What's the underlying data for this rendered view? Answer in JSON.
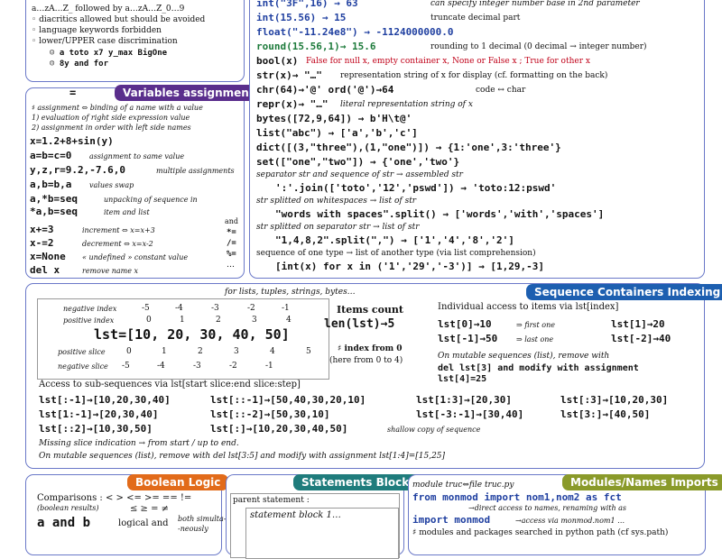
{
  "identifiers": {
    "rule1": "a…zA…Z_ followed by a…zA…Z_0…9",
    "rule2": "◦ diacritics allowed but should be avoided",
    "rule3": "◦ language keywords forbidden",
    "rule4": "◦ lower/UPPER case discrimination",
    "ex_ok": "☺ a toto x7 y_max BigOne",
    "ex_bad": "☹ 8y and for"
  },
  "conversions": {
    "lines": [
      {
        "code": "int(\"3F\",16) → 63",
        "note": "can specify integer number base in 2nd parameter"
      },
      {
        "code": "int(15.56) → 15",
        "note": "truncate decimal part"
      },
      {
        "code": "float(\"-11.24e8\") → -1124000000.0",
        "note": ""
      },
      {
        "code": "round(15.56,1)→ 15.6",
        "note": "rounding to 1 decimal (0 decimal → integer number)"
      },
      {
        "code": "bool(x)",
        "note": "False for null x, empty container x, None or False x ; True for other x"
      },
      {
        "code": "str(x)→ \"…\"",
        "note": "representation string of x for display (cf. formatting on the back)"
      },
      {
        "code": "chr(64)→'@'  ord('@')→64",
        "note": "code ↔ char"
      },
      {
        "code": "repr(x)→ \"…\"",
        "note": "literal representation string of x"
      },
      {
        "code": "bytes([72,9,64]) → b'H\\t@'",
        "note": ""
      },
      {
        "code": "list(\"abc\") → ['a','b','c']",
        "note": ""
      },
      {
        "code": "dict([(3,\"three\"),(1,\"one\")]) → {1:'one',3:'three'}",
        "note": ""
      },
      {
        "code": "set([\"one\",\"two\"]) → {'one','two'}",
        "note": ""
      }
    ],
    "sep_text": "separator str and sequence of str → assembled str",
    "join_code": "':'.join(['toto','12','pswd']) → 'toto:12:pswd'",
    "split_ws_text": "str splitted on whitespaces → list of str",
    "split_ws_code": "\"words with  spaces\".split() → ['words','with','spaces']",
    "split_sep_text": "str splitted on separator str → list of str",
    "split_sep_code": "\"1,4,8,2\".split(\",\") → ['1','4','8','2']",
    "seq_text": "sequence of one type → list of another type (via list comprehension)",
    "seq_code": "[int(x) for x in ('1','29','-3')] → [1,29,-3]"
  },
  "variables": {
    "title": "Variables assignment",
    "eq": "=",
    "intro1": "♯ assignment ⇔ binding of a name with a value",
    "intro2": "1) evaluation of right side expression value",
    "intro3": "2) assignment in order with left side names",
    "rows": [
      {
        "code": "x=1.2+8+sin(y)",
        "note": ""
      },
      {
        "code": "a=b=c=0",
        "note": "assignment to same value"
      },
      {
        "code": "y,z,r=9.2,-7.6,0",
        "note": "multiple assignments"
      },
      {
        "code": "a,b=b,a",
        "note": "values swap"
      },
      {
        "code": "a,*b=seq",
        "note": "unpacking of sequence in"
      },
      {
        "code": "*a,b=seq",
        "note": "item and list"
      },
      {
        "code": "x+=3",
        "note": "increment ⇔ x=x+3"
      },
      {
        "code": "x-=2",
        "note": "decrement ⇔ x=x-2"
      },
      {
        "code": "x=None",
        "note": "« undefined » constant value"
      },
      {
        "code": "del x",
        "note": "remove name x"
      }
    ],
    "side_ops": [
      "and",
      "*=",
      "/=",
      "%=",
      "…"
    ]
  },
  "sequence": {
    "title": "Sequence Containers Indexing",
    "subtitle": "for lists, tuples, strings, bytes…",
    "neg_label": "negative index",
    "pos_label": "positive index",
    "neg_index": [
      "-5",
      "-4",
      "-3",
      "-2",
      "-1"
    ],
    "pos_index": [
      "0",
      "1",
      "2",
      "3",
      "4"
    ],
    "lst_code": "lst=[10, 20, 30, 40, 50]",
    "pos_slice_label": "positive slice",
    "neg_slice_label": "negative slice",
    "pos_slice": [
      "0",
      "1",
      "2",
      "3",
      "4",
      "5"
    ],
    "neg_slice": [
      "-5",
      "-4",
      "-3",
      "-2",
      "-1"
    ],
    "count_title": "Items count",
    "count_code": "len(lst)→5",
    "index_from": "♯ index from 0",
    "index_here": "(here from 0 to 4)",
    "access_title": "Individual access to items via lst[index]",
    "acc": [
      {
        "code": "lst[0]→10",
        "note": "⇒ first one"
      },
      {
        "code": "lst[-1]→50",
        "note": "⇒ last one"
      },
      {
        "code": "lst[1]→20",
        "note": ""
      },
      {
        "code": "lst[-2]→40",
        "note": ""
      }
    ],
    "mutable1": "On mutable sequences (list), remove with",
    "mutable2": "del lst[3] and modify with assignment",
    "mutable3": "lst[4]=25",
    "sub_title": "Access to sub-sequences via lst[start slice:end slice:step]",
    "slices": [
      "lst[:-1]→[10,20,30,40]",
      "lst[::-1]→[50,40,30,20,10]",
      "lst[1:3]→[20,30]",
      "lst[:3]→[10,20,30]",
      "lst[1:-1]→[20,30,40]",
      "lst[::-2]→[50,30,10]",
      "lst[-3:-1]→[30,40]",
      "lst[3:]→[40,50]",
      "lst[::2]→[10,30,50]",
      "lst[:]→[10,20,30,40,50]"
    ],
    "shallow": "shallow copy of sequence",
    "missing": "Missing slice indication → from start / up to end.",
    "mut_slice": "On mutable sequences (list), remove with del lst[3:5] and modify with assignment lst[1:4]=[15,25]"
  },
  "boolean": {
    "title": "Boolean Logic",
    "cmp": "Comparisons : < > <= >= == !=",
    "results": "(boolean results)",
    "math": "≤ ≥ = ≠",
    "and_code": "a and b",
    "and_note": "logical and",
    "both": "both simulta-",
    "neously": "-neously"
  },
  "statements": {
    "title": "Statements Blocks",
    "parent": "parent statement :",
    "block": "statement block 1…"
  },
  "modules": {
    "title": "Modules/Names Imports",
    "line1": "module truc⇔file truc.py",
    "line2": "from monmod import nom1,nom2 as fct",
    "line3": "→direct access to names, renaming with as",
    "line4": "import monmod",
    "line4b": "→access via monmod.nom1 …",
    "line5": "♯ modules and packages searched in python path (cf sys.path)"
  },
  "colors": {
    "border": "#6a78c8",
    "vars_title": "#5a2e8c",
    "seq_title": "#1d5fb0",
    "bool_title": "#e26b1a",
    "stmt_title": "#1f7c7c",
    "mod_title": "#8a9a2a"
  }
}
